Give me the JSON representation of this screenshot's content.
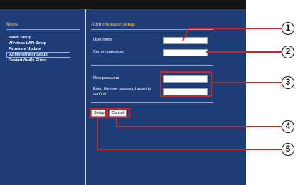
{
  "sidebar": {
    "heading": "Menu",
    "items": [
      {
        "label": "Basic Setup"
      },
      {
        "label": "Wireless LAN Setup"
      },
      {
        "label": "Firmware Update"
      },
      {
        "label": "Administrator Setup"
      },
      {
        "label": "Restart Audio Client"
      }
    ]
  },
  "main": {
    "heading": "Administrator setup",
    "user_name_label": "User name",
    "user_name_value": "",
    "current_password_label": "Current password",
    "current_password_value": "",
    "new_password_label": "New password",
    "new_password_value": "",
    "confirm_password_label": "Enter the new password again to confirm",
    "confirm_password_value": "",
    "setup_button": "Setup",
    "cancel_button": "Cancel"
  },
  "callouts": {
    "accent_color": "#c9262c",
    "labels": [
      "1",
      "2",
      "3",
      "4",
      "5"
    ]
  }
}
